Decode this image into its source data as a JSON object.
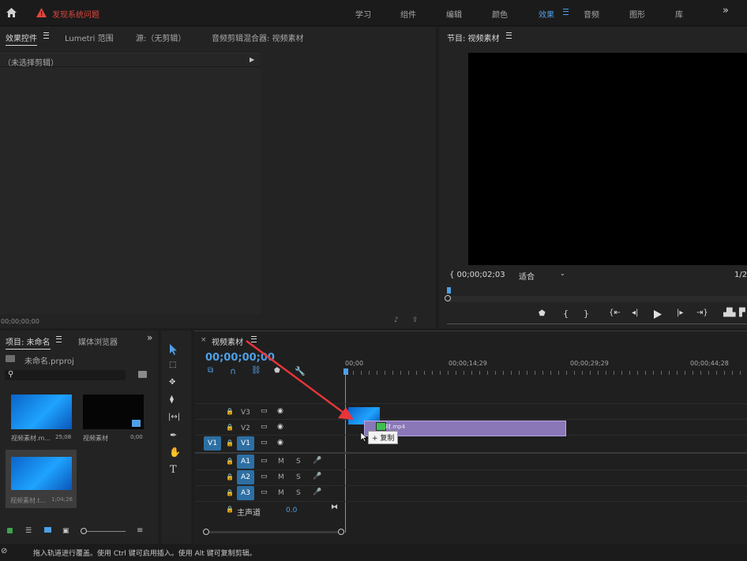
{
  "topbar": {
    "alert_text": "发现系统问题",
    "workspaces": [
      "学习",
      "组件",
      "编辑",
      "颜色",
      "效果",
      "音频",
      "图形",
      "库"
    ],
    "active_workspace": "效果",
    "more": "»"
  },
  "source_panel": {
    "tabs": [
      "效果控件",
      "Lumetri 范围",
      "源:（无剪辑）",
      "音频剪辑混合器: 视频素材"
    ],
    "no_clip": "（未选择剪辑）",
    "timecode": "00;00;00;00"
  },
  "program_monitor": {
    "title": "节目: 视频素材",
    "timecode": "00;00;02;03",
    "fit_label": "适合",
    "resolution": "1/2"
  },
  "project_panel": {
    "tab_project": "项目: 未命名",
    "tab_media": "媒体浏览器",
    "project_file": "未命名.prproj",
    "search_placeholder": "",
    "items": [
      {
        "name": "视频素材.m...",
        "duration": "25;08"
      },
      {
        "name": "视频素材",
        "duration": "0;00"
      },
      {
        "name": "视频素材.t...",
        "duration": "1;04;26"
      }
    ]
  },
  "timeline": {
    "title": "视频素材",
    "timecode": "00;00;00;00",
    "ruler": [
      "00;00",
      "00;00;14;29",
      "00;00;29;29",
      "00;00;44;28"
    ],
    "video_tracks": [
      "V3",
      "V2",
      "V1"
    ],
    "audio_tracks": [
      "A1",
      "A2",
      "A3"
    ],
    "source_patch_v": "V1",
    "mute": "M",
    "solo": "S",
    "master_label": "主声道",
    "master_value": "0.0",
    "clip_label": "材.mp4",
    "tooltip": "+ 复制"
  },
  "status_bar": {
    "text": "拖入轨道进行覆盖。使用 Ctrl 键可启用插入。使用 Alt 键可复制剪辑。"
  },
  "colors": {
    "accent": "#4f9fe6",
    "alert": "#e0463d",
    "clip_purple": "#8a77b8",
    "track_blue": "#2d6fa3",
    "arrow_red": "#e8353a"
  }
}
